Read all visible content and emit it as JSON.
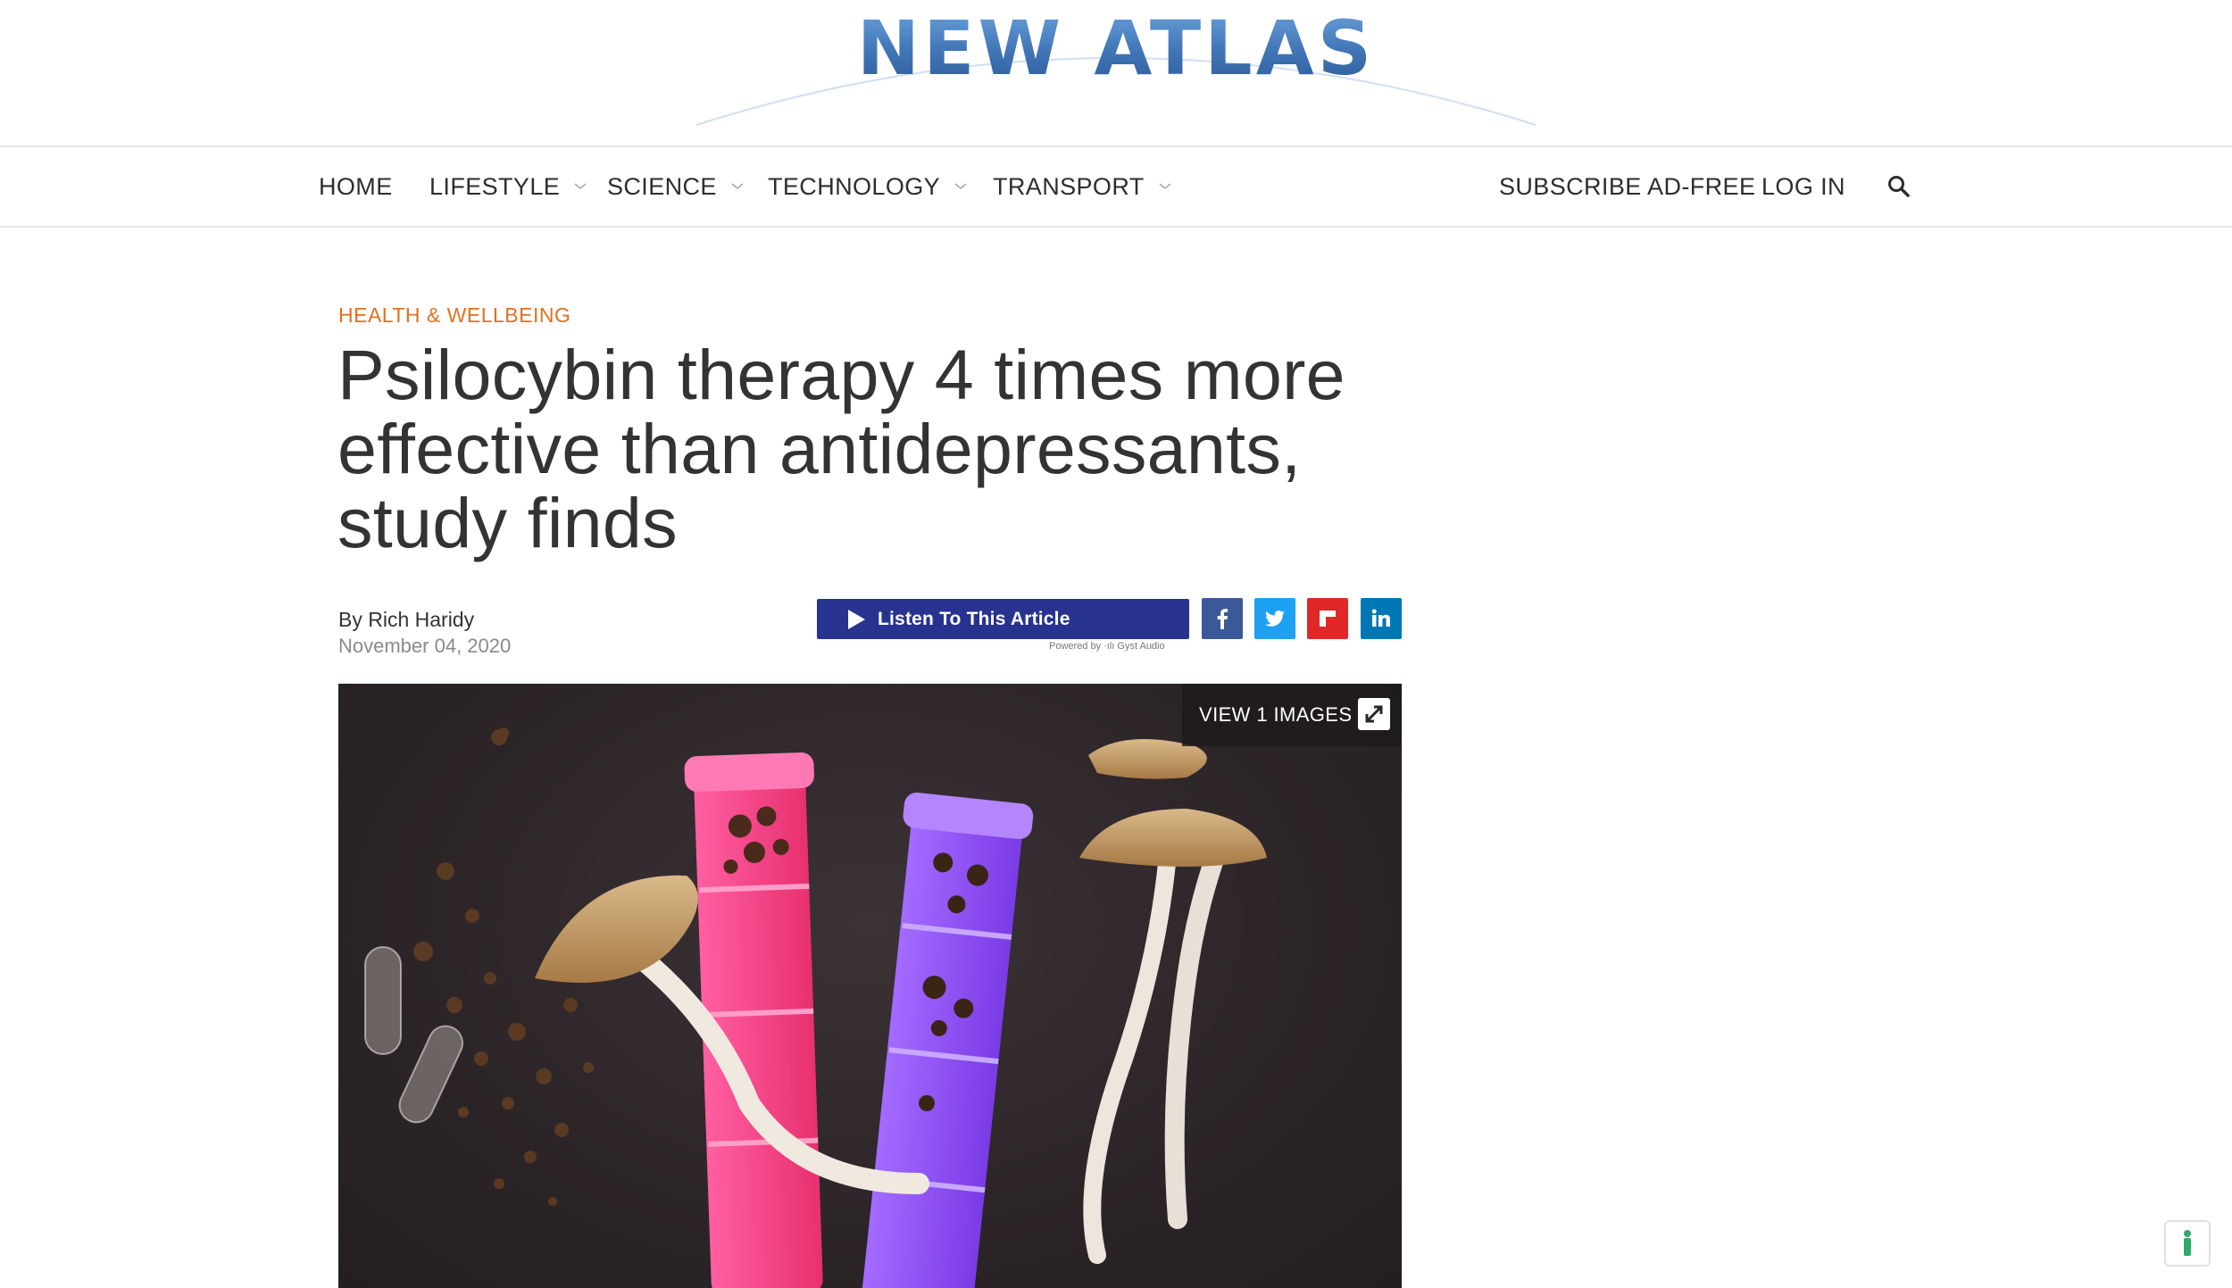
{
  "site": {
    "logo_text": "NEW ATLAS"
  },
  "nav": {
    "items": [
      {
        "label": "HOME",
        "has_dropdown": false
      },
      {
        "label": "LIFESTYLE",
        "has_dropdown": true
      },
      {
        "label": "SCIENCE",
        "has_dropdown": true
      },
      {
        "label": "TECHNOLOGY",
        "has_dropdown": true
      },
      {
        "label": "TRANSPORT",
        "has_dropdown": true
      }
    ],
    "subscribe_label": "SUBSCRIBE AD-FREE",
    "login_label": "LOG IN",
    "search_icon": "search-icon"
  },
  "article": {
    "category": "HEALTH & WELLBEING",
    "title": "Psilocybin therapy 4 times more effective than antidepressants, study finds",
    "byline_prefix": "By ",
    "author": "Rich Haridy",
    "date": "November 04, 2020"
  },
  "audio": {
    "listen_label": "Listen To This Article",
    "powered_by": "Powered by ·ılı Gyst Audio"
  },
  "share": [
    {
      "network": "facebook",
      "icon": "facebook-icon",
      "color": "#3b5998"
    },
    {
      "network": "twitter",
      "icon": "twitter-icon",
      "color": "#1da1f2"
    },
    {
      "network": "flipboard",
      "icon": "flipboard-icon",
      "color": "#e12828"
    },
    {
      "network": "linkedin",
      "icon": "linkedin-icon",
      "color": "#0077b5"
    }
  ],
  "gallery": {
    "view_label": "VIEW 1 IMAGES",
    "icon": "expand-icon"
  },
  "colors": {
    "accent": "#e2701f",
    "nav_text": "#2d2d2d",
    "listen_bg": "#28328f",
    "logo_blue": "#4f86c6"
  }
}
